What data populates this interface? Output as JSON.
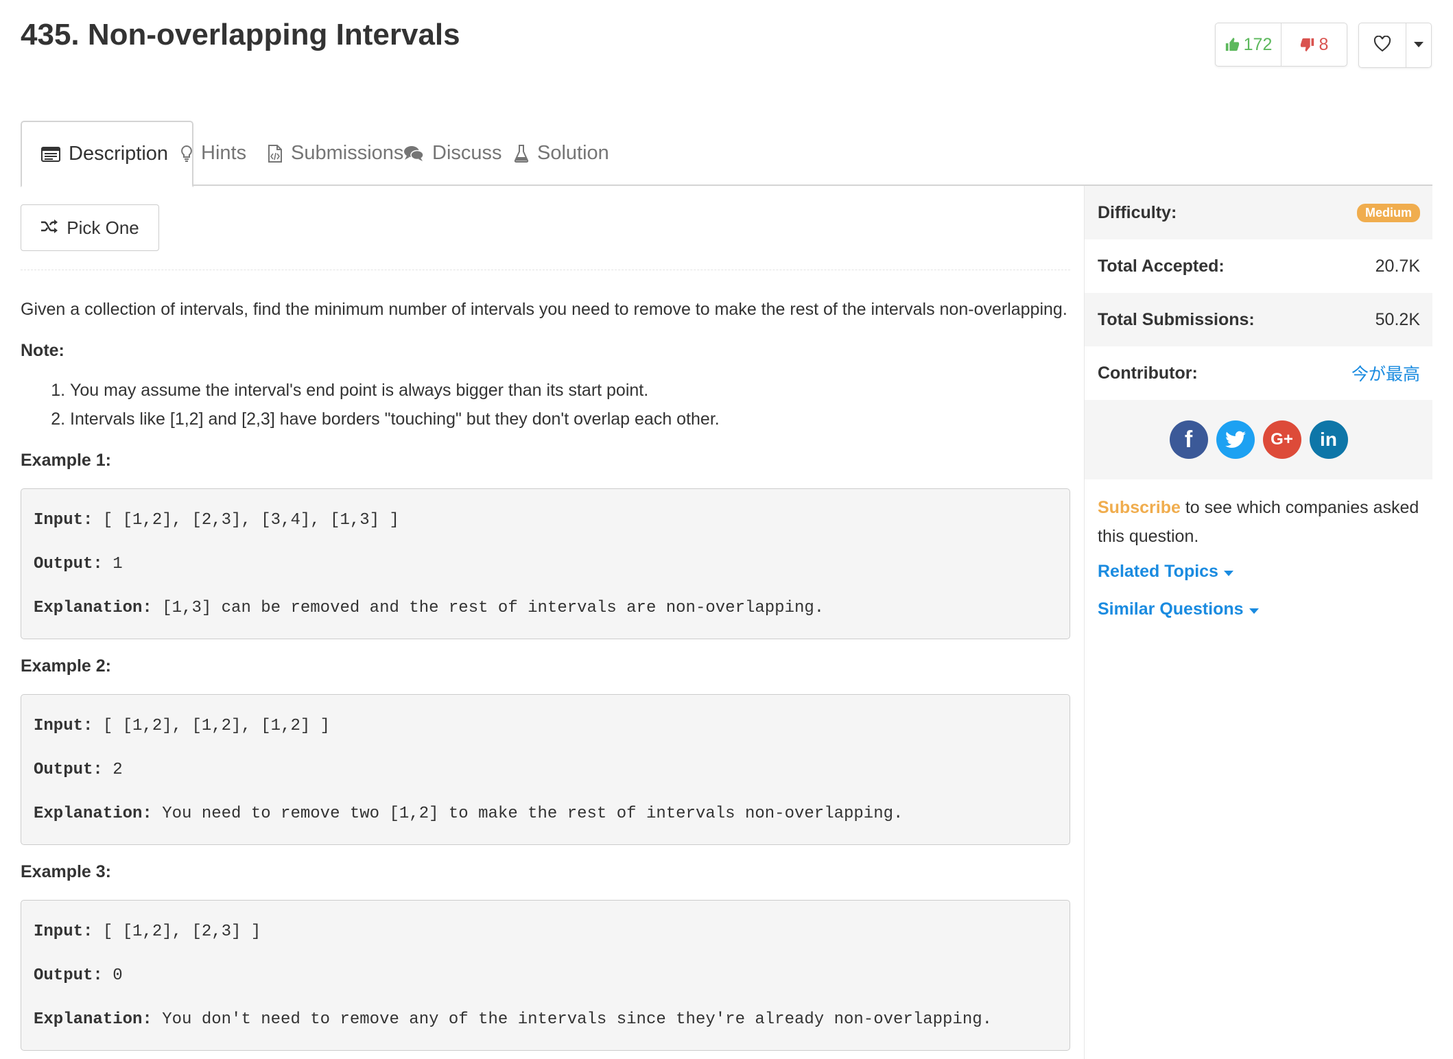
{
  "header": {
    "title": "435. Non-overlapping Intervals",
    "upvotes": "172",
    "downvotes": "8"
  },
  "tabs": [
    {
      "label": "Description",
      "icon": "description-icon"
    },
    {
      "label": "Hints",
      "icon": "lightbulb-icon"
    },
    {
      "label": "Submissions",
      "icon": "code-file-icon"
    },
    {
      "label": "Discuss",
      "icon": "comments-icon"
    },
    {
      "label": "Solution",
      "icon": "flask-icon"
    }
  ],
  "pick_one": "Pick One",
  "description": {
    "text": "Given a collection of intervals, find the minimum number of intervals you need to remove to make the rest of the intervals non-overlapping.",
    "note_label": "Note:",
    "notes": [
      "You may assume the interval's end point is always bigger than its start point.",
      "Intervals like [1,2] and [2,3] have borders \"touching\" but they don't overlap each other."
    ]
  },
  "examples": [
    {
      "label": "Example 1:",
      "input_key": "Input:",
      "input": " [ [1,2], [2,3], [3,4], [1,3] ]",
      "output_key": "Output:",
      "output": " 1",
      "explanation_key": "Explanation:",
      "explanation": " [1,3] can be removed and the rest of intervals are non-overlapping."
    },
    {
      "label": "Example 2:",
      "input_key": "Input:",
      "input": " [ [1,2], [1,2], [1,2] ]",
      "output_key": "Output:",
      "output": " 2",
      "explanation_key": "Explanation:",
      "explanation": " You need to remove two [1,2] to make the rest of intervals non-overlapping."
    },
    {
      "label": "Example 3:",
      "input_key": "Input:",
      "input": " [ [1,2], [2,3] ]",
      "output_key": "Output:",
      "output": " 0",
      "explanation_key": "Explanation:",
      "explanation": " You don't need to remove any of the intervals since they're already non-overlapping."
    }
  ],
  "sidebar": {
    "difficulty_label": "Difficulty:",
    "difficulty": "Medium",
    "accepted_label": "Total Accepted:",
    "accepted": "20.7K",
    "submissions_label": "Total Submissions:",
    "submissions": "50.2K",
    "contributor_label": "Contributor:",
    "contributor": "今が最高",
    "share": {
      "googleplus": "G+",
      "linkedin": "in",
      "facebook": "f"
    },
    "subscribe_link": "Subscribe",
    "subscribe_text": " to see which companies asked this question.",
    "related_topics": "Related Topics",
    "similar_questions": "Similar Questions"
  },
  "colors": {
    "upvote": "#5cb85c",
    "downvote": "#d9534f",
    "medium_badge": "#f0ad4e",
    "link": "#1a8be0"
  }
}
